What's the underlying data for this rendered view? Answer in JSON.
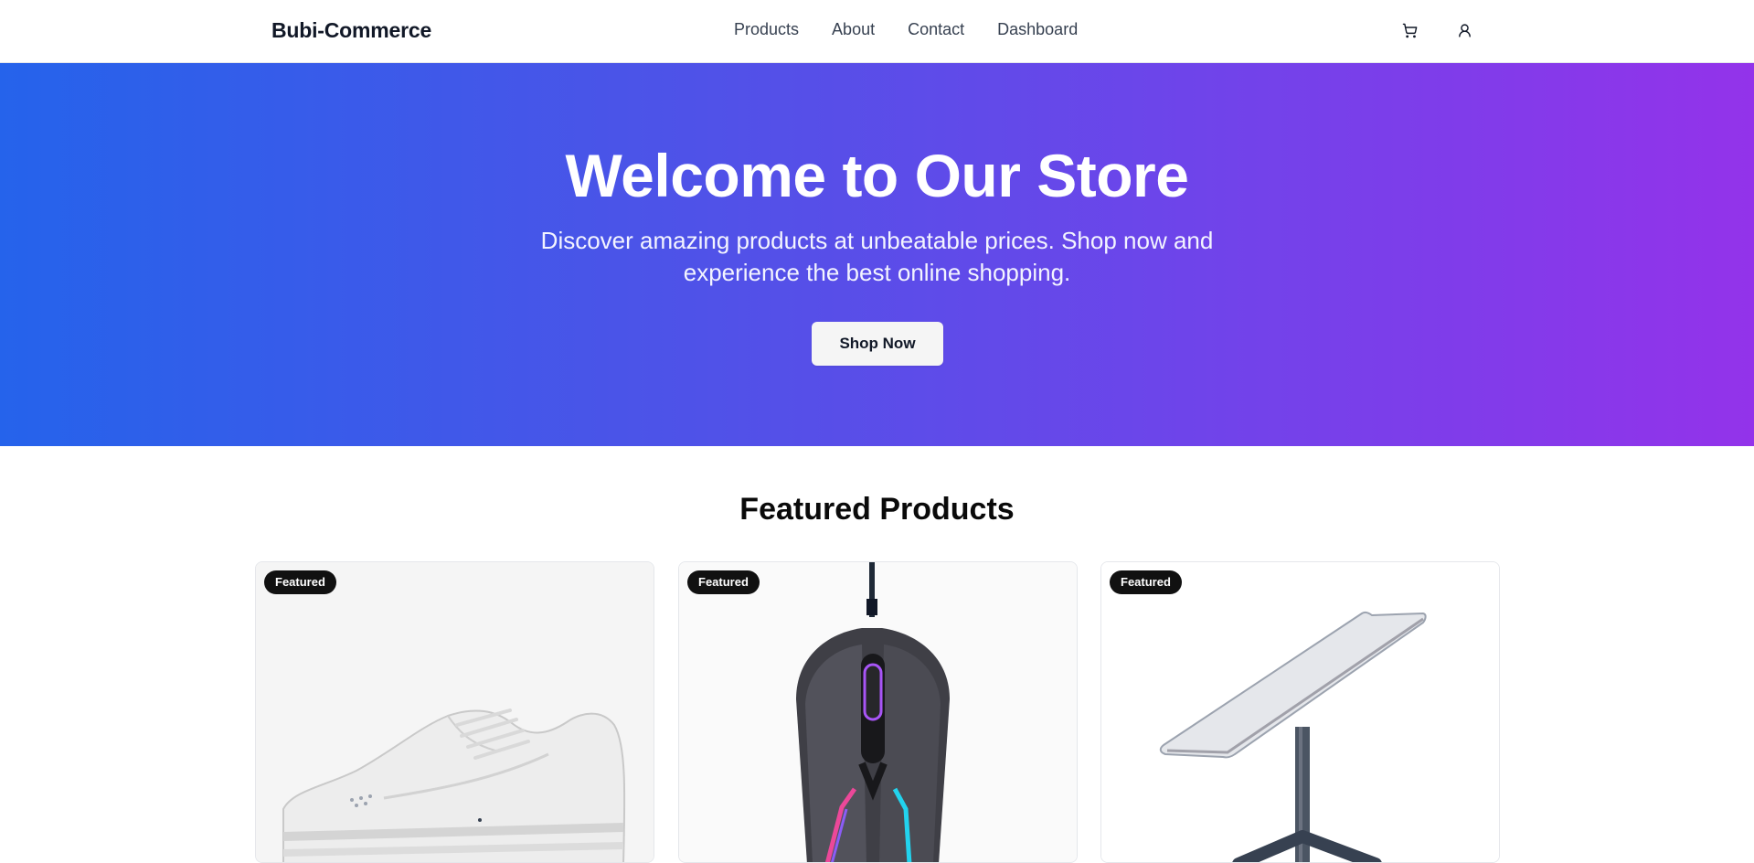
{
  "header": {
    "brand": "Bubi-Commerce",
    "nav": [
      "Products",
      "About",
      "Contact",
      "Dashboard"
    ],
    "icons": [
      "cart-icon",
      "user-icon"
    ]
  },
  "hero": {
    "title": "Welcome to Our Store",
    "subtitle": "Discover amazing products at unbeatable prices. Shop now and experience the best online shopping.",
    "button_label": "Shop Now",
    "gradient_start": "#2563eb",
    "gradient_end": "#9333ea"
  },
  "featured": {
    "title": "Featured Products",
    "products": [
      {
        "badge": "Featured",
        "image": "white-sneaker"
      },
      {
        "badge": "Featured",
        "image": "gaming-mouse"
      },
      {
        "badge": "Featured",
        "image": "satellite-dish"
      }
    ]
  }
}
